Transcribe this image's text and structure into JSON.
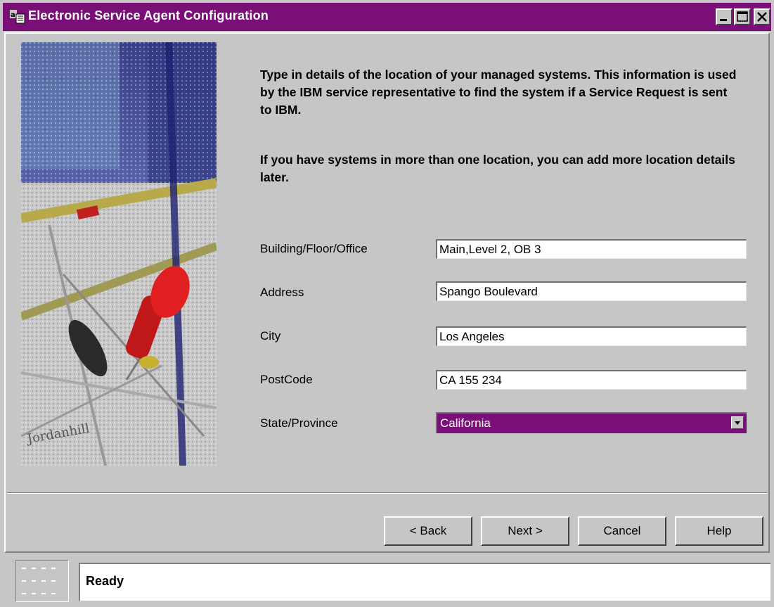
{
  "window": {
    "title": "Electronic Service Agent Configuration",
    "title_bar_color": "#7a0f78",
    "controls": {
      "minimize": "minimize-icon",
      "maximize": "maximize-icon",
      "close": "close-icon"
    }
  },
  "intro": {
    "paragraph1": "Type in details of the location of your managed systems. This information is used by the IBM service representative to find the system if a Service Request is sent to IBM.",
    "paragraph2": "If you have systems in more than one location, you can add more location details later."
  },
  "form": {
    "building": {
      "label": "Building/Floor/Office",
      "value": "Main,Level 2, OB 3"
    },
    "address": {
      "label": "Address",
      "value": "Spango Boulevard"
    },
    "city": {
      "label": "City",
      "value": "Los Angeles"
    },
    "postcode": {
      "label": "PostCode",
      "value": "CA 155 234"
    },
    "state": {
      "label": "State/Province",
      "value": "California"
    }
  },
  "buttons": {
    "back": "< Back",
    "next": "Next >",
    "cancel": "Cancel",
    "help": "Help"
  },
  "status": {
    "text": "Ready"
  }
}
